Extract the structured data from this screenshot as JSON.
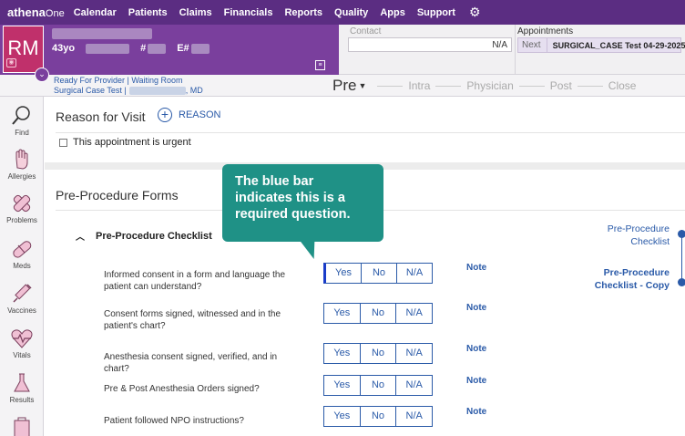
{
  "topnav": {
    "brand": "athena",
    "brand_suffix": "One",
    "items": [
      "Calendar",
      "Patients",
      "Claims",
      "Financials",
      "Reports",
      "Quality",
      "Apps",
      "Support"
    ]
  },
  "patient": {
    "initials": "RM",
    "age": "43yo",
    "mrn_prefix": "#",
    "enterprise_prefix": "E#"
  },
  "contact": {
    "label": "Contact",
    "value": "N/A"
  },
  "appointments": {
    "label": "Appointments",
    "next_label": "Next",
    "next_value": "SURGICAL_CASE Test 04-29-2025"
  },
  "status": {
    "line1": "Ready For Provider | Waiting Room",
    "line2_prefix": "Surgical Case Test |",
    "line2_suffix": ", MD"
  },
  "stages": {
    "current": "Pre",
    "others": [
      "Intra",
      "Physician",
      "Post",
      "Close"
    ]
  },
  "sidebar": {
    "items": [
      {
        "label": "Find",
        "icon": "magnifier-icon"
      },
      {
        "label": "Allergies",
        "icon": "hand-icon"
      },
      {
        "label": "Problems",
        "icon": "bandage-icon"
      },
      {
        "label": "Meds",
        "icon": "pill-icon"
      },
      {
        "label": "Vaccines",
        "icon": "syringe-icon"
      },
      {
        "label": "Vitals",
        "icon": "heart-pulse-icon"
      },
      {
        "label": "Results",
        "icon": "flask-icon"
      }
    ]
  },
  "reason_for_visit": {
    "title": "Reason for Visit",
    "add_label": "REASON",
    "urgent_label": "This appointment is urgent"
  },
  "forms": {
    "title": "Pre-Procedure Forms",
    "checklist_title": "Pre-Procedure Checklist",
    "options": [
      "Yes",
      "No",
      "N/A"
    ],
    "note_label": "Note",
    "questions": [
      "Informed consent in a form and language the patient can understand?",
      "Consent forms signed, witnessed and in the patient's chart?",
      "Anesthesia consent signed, verified, and in chart?",
      "Pre & Post Anesthesia Orders signed?",
      "Patient followed NPO instructions?"
    ],
    "toc": [
      {
        "line1": "Pre-Procedure",
        "line2": "Checklist"
      },
      {
        "line1": "Pre-Procedure",
        "line2": "Checklist - Copy"
      }
    ]
  },
  "tooltip": {
    "text": "The blue bar indicates this is a required question."
  },
  "colors": {
    "nav_purple": "#5b2d82",
    "banner_purple": "#7a3f9d",
    "avatar": "#c0306b",
    "link_blue": "#2a5aa8",
    "tooltip_teal": "#1f9186",
    "required_bar": "#1a3cc9"
  }
}
